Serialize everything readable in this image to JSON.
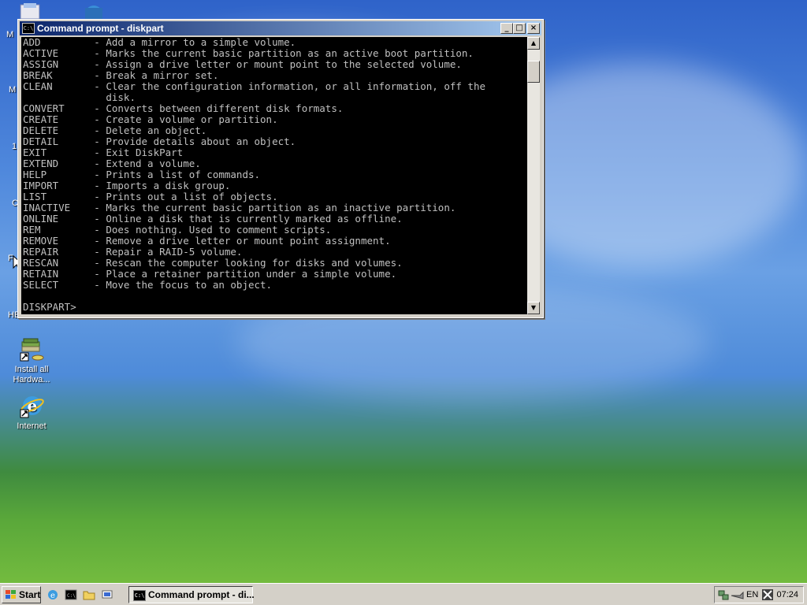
{
  "window": {
    "title": "Command prompt - diskpart",
    "title_icon": "C:\\",
    "buttons": {
      "minimize": "_",
      "maximize": "□",
      "close": "×"
    }
  },
  "console": {
    "commands": [
      {
        "cmd": "ADD",
        "desc": "Add a mirror to a simple volume."
      },
      {
        "cmd": "ACTIVE",
        "desc": "Marks the current basic partition as an active boot partition."
      },
      {
        "cmd": "ASSIGN",
        "desc": "Assign a drive letter or mount point to the selected volume."
      },
      {
        "cmd": "BREAK",
        "desc": "Break a mirror set."
      },
      {
        "cmd": "CLEAN",
        "desc": "Clear the configuration information, or all information, off the",
        "desc2": "disk."
      },
      {
        "cmd": "CONVERT",
        "desc": "Converts between different disk formats."
      },
      {
        "cmd": "CREATE",
        "desc": "Create a volume or partition."
      },
      {
        "cmd": "DELETE",
        "desc": "Delete an object."
      },
      {
        "cmd": "DETAIL",
        "desc": "Provide details about an object."
      },
      {
        "cmd": "EXIT",
        "desc": "Exit DiskPart"
      },
      {
        "cmd": "EXTEND",
        "desc": "Extend a volume."
      },
      {
        "cmd": "HELP",
        "desc": "Prints a list of commands."
      },
      {
        "cmd": "IMPORT",
        "desc": "Imports a disk group."
      },
      {
        "cmd": "LIST",
        "desc": "Prints out a list of objects."
      },
      {
        "cmd": "INACTIVE",
        "desc": "Marks the current basic partition as an inactive partition."
      },
      {
        "cmd": "ONLINE",
        "desc": "Online a disk that is currently marked as offline."
      },
      {
        "cmd": "REM",
        "desc": "Does nothing. Used to comment scripts."
      },
      {
        "cmd": "REMOVE",
        "desc": "Remove a drive letter or mount point assignment."
      },
      {
        "cmd": "REPAIR",
        "desc": "Repair a RAID-5 volume."
      },
      {
        "cmd": "RESCAN",
        "desc": "Rescan the computer looking for disks and volumes."
      },
      {
        "cmd": "RETAIN",
        "desc": "Place a retainer partition under a simple volume."
      },
      {
        "cmd": "SELECT",
        "desc": "Move the focus to an object."
      }
    ],
    "prompt": "DISKPART>"
  },
  "desktop": {
    "icons": [
      {
        "name": "install-hardware-icon",
        "label_line1": "Install all",
        "label_line2": "Hardwa..."
      },
      {
        "name": "internet-icon",
        "label_line1": "Internet",
        "label_line2": ""
      }
    ],
    "partial_labels": [
      "M",
      "M",
      "1",
      "C",
      "F",
      "HE"
    ]
  },
  "taskbar": {
    "start_label": "Start",
    "task_label": "Command prompt - di...",
    "tray_lang": "EN",
    "clock": "07:24"
  },
  "colors": {
    "title_start": "#0a246a",
    "title_end": "#a6caf0",
    "console_bg": "#000000",
    "console_fg": "#c0c0c0",
    "face": "#d4d0c8"
  }
}
